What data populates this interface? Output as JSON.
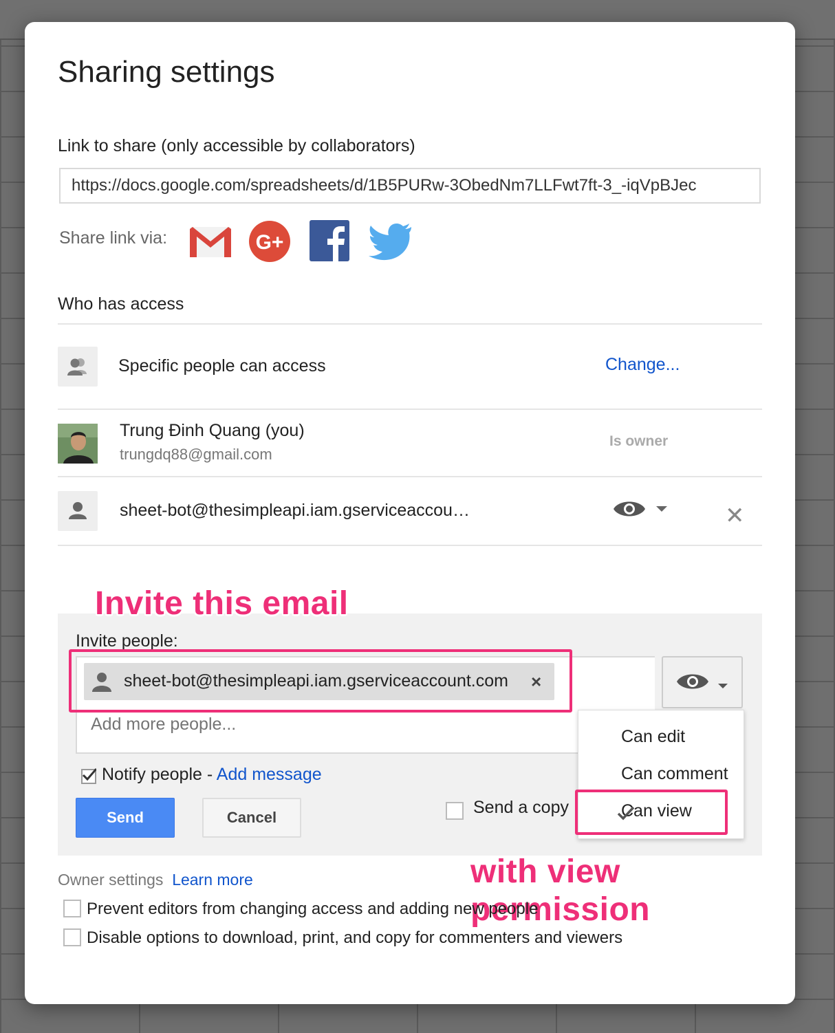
{
  "dialog": {
    "title": "Sharing settings",
    "link_label": "Link to share (only accessible by collaborators)",
    "link_url": "https://docs.google.com/spreadsheets/d/1B5PURw-3ObedNm7LLFwt7ft-3_-iqVpBJec",
    "share_via_label": "Share link via:",
    "share_via_icons": [
      "gmail-icon",
      "google-plus-icon",
      "facebook-icon",
      "twitter-icon"
    ]
  },
  "access": {
    "label": "Who has access",
    "general": {
      "text": "Specific people can access",
      "change_link": "Change..."
    },
    "people": [
      {
        "name": "Trung Đinh Quang (you)",
        "email": "trungdq88@gmail.com",
        "role": "Is owner"
      },
      {
        "name": "sheet-bot@thesimpleapi.iam.gserviceaccou…",
        "role_icon": "eye-icon"
      }
    ]
  },
  "invite": {
    "label": "Invite people:",
    "chip_email": "sheet-bot@thesimpleapi.iam.gserviceaccount.com",
    "chip_close": "×",
    "add_more_placeholder": "Add more people...",
    "notify_label": "Notify people - ",
    "notify_checked": true,
    "add_message_link": "Add message",
    "send_label": "Send",
    "cancel_label": "Cancel",
    "send_copy_label": "Send a copy",
    "permission_menu": {
      "options": [
        "Can edit",
        "Can comment",
        "Can view"
      ],
      "selected": "Can view"
    }
  },
  "owner_settings": {
    "label": "Owner settings",
    "learn_more": "Learn more",
    "options": [
      {
        "label": "Prevent editors from changing access and adding new people",
        "checked": false
      },
      {
        "label": "Disable options to download, print, and copy for commenters and viewers",
        "checked": false
      }
    ]
  },
  "annotations": {
    "invite_note": "Invite this email",
    "permission_note": "with view permission",
    "color": "#ee2f78"
  },
  "colors": {
    "accent_blue": "#4a8af4",
    "link_blue": "#1155cc"
  }
}
